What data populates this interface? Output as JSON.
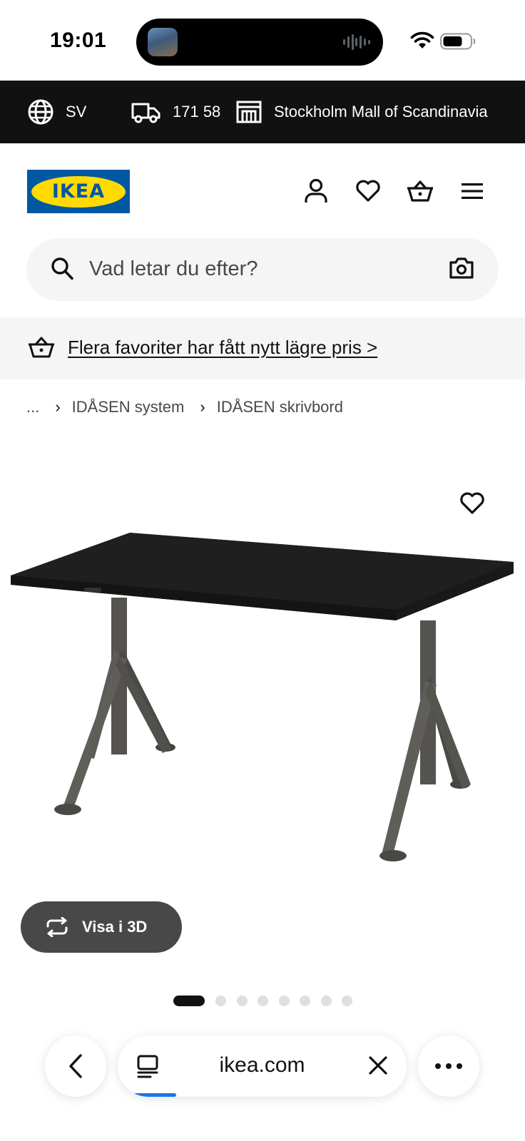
{
  "status_bar": {
    "time": "19:01"
  },
  "store_bar": {
    "language": "SV",
    "zip": "171 58",
    "store": "Stockholm Mall of Scandinavia"
  },
  "header": {
    "logo_text": "IKEA"
  },
  "search": {
    "placeholder": "Vad letar du efter?"
  },
  "promo": {
    "text": "Flera favoriter har fått nytt lägre pris >"
  },
  "breadcrumb": {
    "items": [
      "...",
      "IDÅSEN system",
      "IDÅSEN skrivbord"
    ]
  },
  "product": {
    "view3d_label": "Visa i 3D",
    "image_count": 8,
    "active_image": 1
  },
  "browser": {
    "url": "ikea.com",
    "load_progress": 0.15
  },
  "colors": {
    "store_bar_bg": "#111111",
    "ikea_blue": "#0058a3",
    "ikea_yellow": "#ffdb00",
    "view3d_bg": "#484848",
    "progress": "#1a73e8"
  }
}
